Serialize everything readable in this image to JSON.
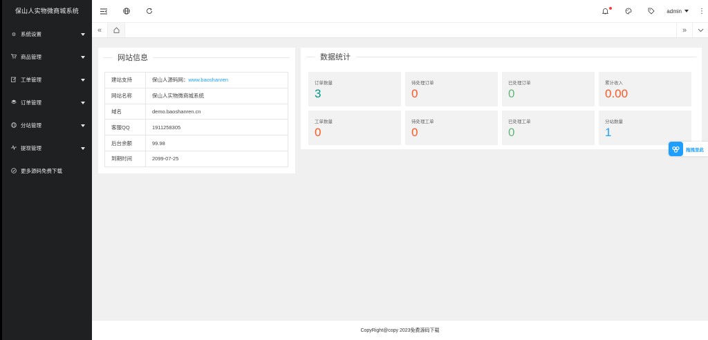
{
  "app": {
    "title": "保山人实物微商城系统"
  },
  "sidebar": {
    "items": [
      {
        "label": "系统设置",
        "icon": "gear-icon",
        "has_caret": true
      },
      {
        "label": "商品管理",
        "icon": "cart-icon",
        "has_caret": true
      },
      {
        "label": "工单管理",
        "icon": "edit-icon",
        "has_caret": true
      },
      {
        "label": "订单管理",
        "icon": "layers-icon",
        "has_caret": true
      },
      {
        "label": "分站管理",
        "icon": "globe-icon",
        "has_caret": true
      },
      {
        "label": "提现管理",
        "icon": "pulse-icon",
        "has_caret": true
      },
      {
        "label": "更多源码免费下载",
        "icon": "check-circle-icon",
        "has_caret": false
      }
    ]
  },
  "header": {
    "icons": [
      "menu-shrink-icon",
      "globe-icon",
      "refresh-icon"
    ],
    "right_icons": [
      "bell-icon",
      "theme-icon",
      "tag-icon"
    ],
    "user": "admin",
    "notification_color": "#ff3b30"
  },
  "tabs": {
    "prev": "«",
    "next": "»",
    "home_icon": "home-icon"
  },
  "site_info": {
    "title": "网站信息",
    "rows": [
      {
        "key": "建站支持",
        "value": "保山人源码网：",
        "link": "www.baoshanren"
      },
      {
        "key": "网站名称",
        "value": "保山人实物微商城系统"
      },
      {
        "key": "域名",
        "value": "demo.baoshanren.cn"
      },
      {
        "key": "客服QQ",
        "value": "1911258305"
      },
      {
        "key": "后台余额",
        "value": "99.98"
      },
      {
        "key": "到期时间",
        "value": "2099-07-25"
      }
    ]
  },
  "stats": {
    "title": "数据统计",
    "cards": [
      {
        "label": "订单数量",
        "value": "3",
        "color": "#009688"
      },
      {
        "label": "待处理订单",
        "value": "0",
        "color": "#ff5722"
      },
      {
        "label": "已处理订单",
        "value": "0",
        "color": "#5fb878"
      },
      {
        "label": "累计收入",
        "value": "0.00",
        "color": "#ff5722"
      },
      {
        "label": "工单数量",
        "value": "0",
        "color": "#ff5722"
      },
      {
        "label": "待处理工单",
        "value": "0",
        "color": "#ff5722"
      },
      {
        "label": "已处理工单",
        "value": "0",
        "color": "#5fb878"
      },
      {
        "label": "分站数量",
        "value": "1",
        "color": "#1e9fff"
      }
    ]
  },
  "floating_tag": {
    "label": "拖拽至此"
  },
  "footer": {
    "text": "CopyRight@copy 2023免费源码下载"
  }
}
